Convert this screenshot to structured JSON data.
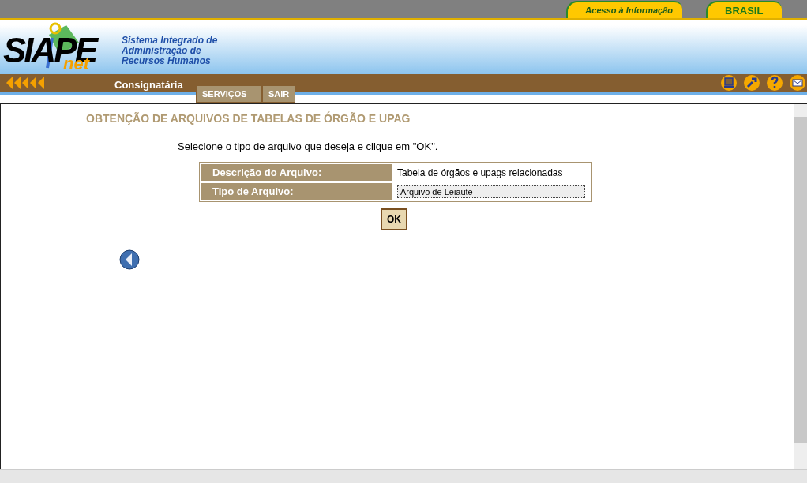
{
  "top_links": [
    {
      "label": "Acesso à Informação",
      "kind": "info"
    },
    {
      "label": "BRASIL",
      "kind": "brasil"
    }
  ],
  "logo": {
    "word": "SIAPE",
    "sub": "net",
    "tagline": [
      "Sistema Integrado de",
      "Administração de",
      "Recursos Humanos"
    ]
  },
  "section": "Consignatária",
  "menu": [
    {
      "label": "SERVIÇOS"
    },
    {
      "label": "SAIR"
    }
  ],
  "toolbar": [
    {
      "kind": "monitor"
    },
    {
      "kind": "tools"
    },
    {
      "kind": "help"
    },
    {
      "kind": "mail"
    }
  ],
  "page_title": "OBTENÇÃO DE ARQUIVOS DE TABELAS DE ÓRGÃO E UPAG",
  "instruction": "Selecione o tipo de arquivo que deseja e clique em \"OK\".",
  "form": [
    {
      "label": "Descrição do Arquivo:",
      "kind": "text",
      "value": "Tabela de órgãos e upags relacionadas"
    },
    {
      "label": "Tipo de Arquivo:",
      "kind": "select",
      "value": "Arquivo de Leiaute"
    }
  ],
  "ok_button": "OK"
}
